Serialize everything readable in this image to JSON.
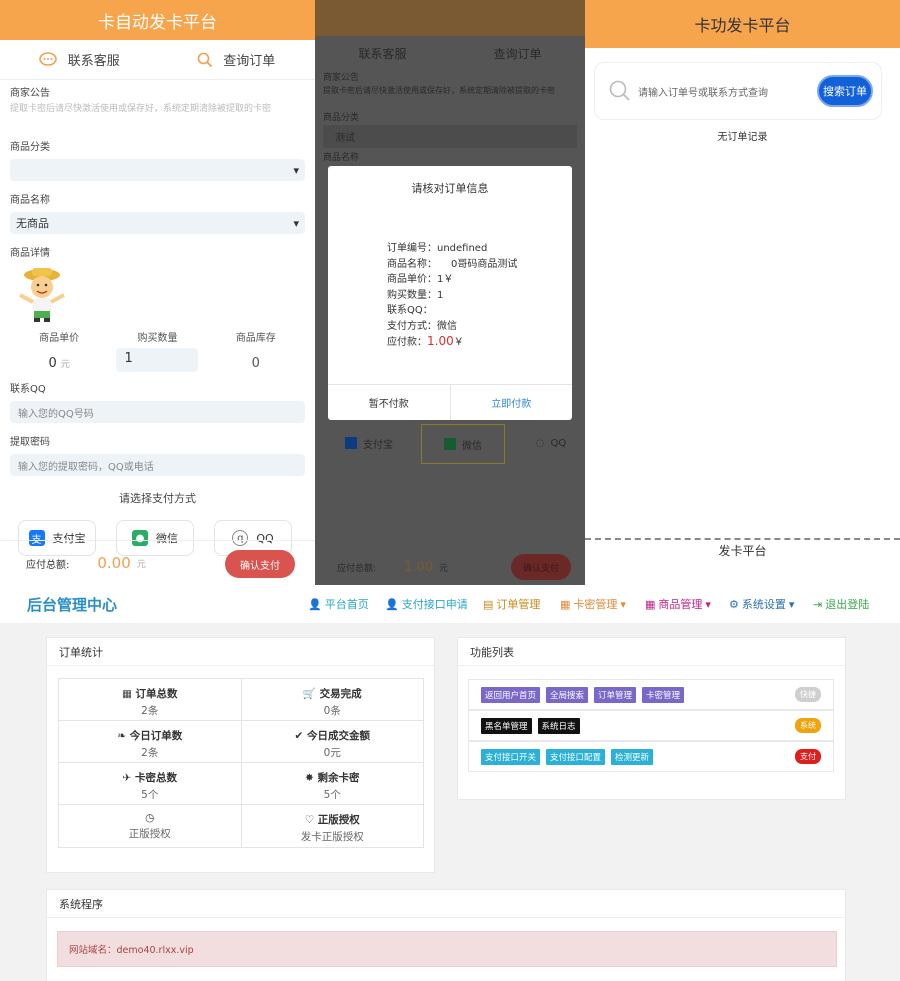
{
  "panel1": {
    "title": "卡自动发卡平台",
    "tabs": {
      "contact": "联系客服",
      "query": "查询订单"
    },
    "notice_label": "商家公告",
    "notice_text": "提取卡密后请尽快激活使用或保存好，系统定期清除被提取的卡密",
    "category_label": "商品分类",
    "category_value": "",
    "product_label": "商品名称",
    "product_value": "无商品",
    "detail_label": "商品详情",
    "price_label": "商品单价",
    "price_value": "0",
    "price_unit": "元",
    "qty_label": "购买数量",
    "qty_value": "1",
    "stock_label": "商品库存",
    "stock_value": "0",
    "qq_label": "联系QQ",
    "qq_placeholder": "输入您的QQ号码",
    "pwd_label": "提取密码",
    "pwd_placeholder": "输入您的提取密码，QQ或电话",
    "pay_title": "请选择支付方式",
    "pay": {
      "alipay": "支付宝",
      "wechat": "微信",
      "qq": "QQ"
    },
    "total_label": "应付总额:",
    "total_value": "0.00",
    "total_unit": "元",
    "confirm": "确认支付"
  },
  "panel2": {
    "tabs": {
      "contact": "联系客服",
      "query": "查询订单"
    },
    "notice_label": "商家公告",
    "notice_text": "提取卡密后请尽快激活使用或保存好，系统定期清除被提取的卡密",
    "category_label": "商品分类",
    "category_value": "测试",
    "product_label": "商品名称",
    "pay": {
      "alipay": "支付宝",
      "wechat": "微信",
      "qq": "QQ"
    },
    "total_label": "应付总额:",
    "total_value": "1.00",
    "total_unit": "元",
    "confirm": "确认支付",
    "modal": {
      "title": "请核对订单信息",
      "order_no": "订单编号：undefined",
      "product_name_label": "商品名称：",
      "product_name": "0哥码商品测试",
      "unit_price": "商品单价：1￥",
      "qty": "购买数量：1",
      "qq": "联系QQ：",
      "pay_method": "支付方式：微信",
      "due_label": "应付款：",
      "due_value": "1.00",
      "due_unit": "￥",
      "cancel": "暂不付款",
      "pay_now": "立即付款"
    }
  },
  "panel3": {
    "title": "卡功发卡平台",
    "search_placeholder": "请输入订单号或联系方式查询",
    "search_button": "搜索订单",
    "no_record": "无订单记录",
    "bottom_title": "发卡平台"
  },
  "admin": {
    "brand": "后台管理中心",
    "nav": [
      {
        "label": "平台首页",
        "color": "#2aa7c9"
      },
      {
        "label": "支付接口申请",
        "color": "#2aa7c9"
      },
      {
        "label": "订单管理",
        "color": "#c98a1b"
      },
      {
        "label": "卡密管理",
        "color": "#e08b3a"
      },
      {
        "label": "商品管理",
        "color": "#c0238a"
      },
      {
        "label": "系统设置",
        "color": "#2c6fb5"
      },
      {
        "label": "退出登陆",
        "color": "#3aa84a"
      }
    ],
    "order_stats": {
      "title": "订单统计",
      "rows": [
        [
          {
            "label": "订单总数",
            "value": "2条"
          },
          {
            "label": "交易完成",
            "value": "0条"
          }
        ],
        [
          {
            "label": "今日订单数",
            "value": "2条"
          },
          {
            "label": "今日成交金额",
            "value": "0元"
          }
        ],
        [
          {
            "label": "卡密总数",
            "value": "5个"
          },
          {
            "label": "剩余卡密",
            "value": "5个"
          }
        ],
        [
          {
            "label": "",
            "value": "正版授权"
          },
          {
            "label": "正版授权",
            "value": "发卡正版授权"
          }
        ]
      ]
    },
    "functions": {
      "title": "功能列表",
      "rows": [
        {
          "tags": [
            "返回用户首页",
            "全局搜索",
            "订单管理",
            "卡密管理"
          ],
          "badge": "快捷",
          "badge_color": "#cfcfcf",
          "tag_color": "#7a67c9"
        },
        {
          "tags": [
            "黑名单管理",
            "系统日志"
          ],
          "badge": "系统",
          "badge_color": "#f0a30a",
          "tag_color": "#111111"
        },
        {
          "tags": [
            "支付接口开关",
            "支付接口配置",
            "检测更新"
          ],
          "badge": "支付",
          "badge_color": "#e01e1e",
          "tag_color": "#2bb0d8"
        }
      ]
    },
    "system": {
      "title": "系统程序",
      "domain": "网站域名：demo40.rlxx.vip"
    }
  }
}
